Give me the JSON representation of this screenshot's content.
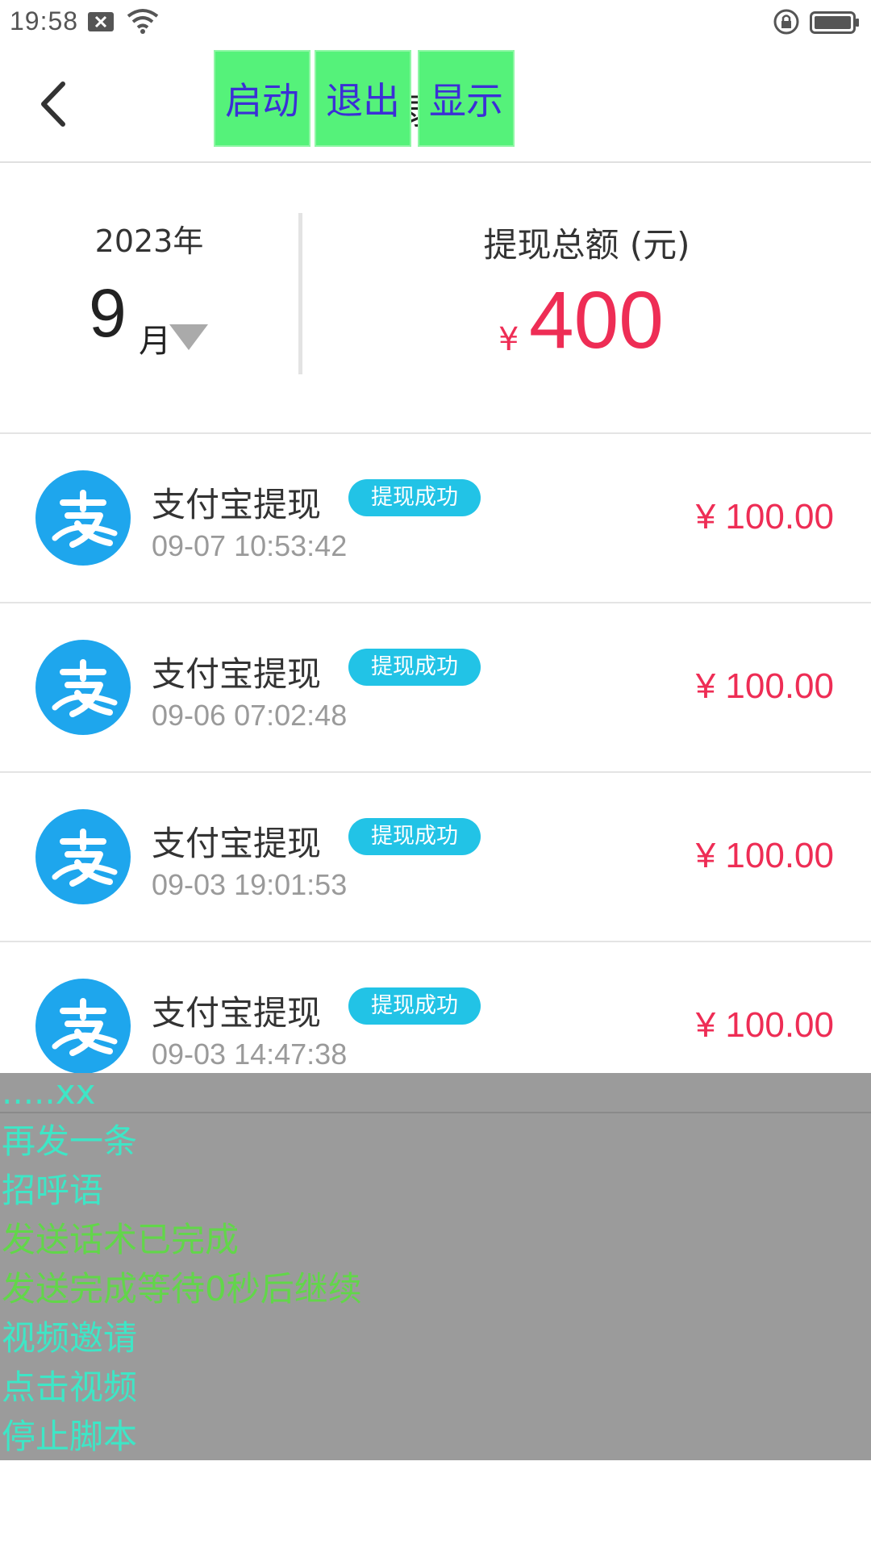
{
  "status_bar": {
    "time": "19:58",
    "icons": [
      "notification-x-icon",
      "wifi-icon",
      "screen-lock-icon",
      "battery-icon"
    ]
  },
  "header": {
    "back_icon": "back-chevron-icon",
    "title_fragment": "录",
    "overlay_buttons": {
      "start": "启动",
      "exit": "退出",
      "show": "显示"
    }
  },
  "summary": {
    "year": "2023年",
    "month": "9",
    "month_unit": "月",
    "total_label": "提现总额 (元)",
    "currency": "¥",
    "total": "400"
  },
  "records": [
    {
      "title": "支付宝提现",
      "status": "提现成功",
      "time": "09-07 10:53:42",
      "amount": "¥ 100.00"
    },
    {
      "title": "支付宝提现",
      "status": "提现成功",
      "time": "09-06 07:02:48",
      "amount": "¥ 100.00"
    },
    {
      "title": "支付宝提现",
      "status": "提现成功",
      "time": "09-03 19:01:53",
      "amount": "¥ 100.00"
    },
    {
      "title": "支付宝提现",
      "status": "提现成功",
      "time": "09-03 14:47:38",
      "amount": "¥ 100.00"
    }
  ],
  "log": {
    "lines": [
      {
        "text": ".....xx",
        "color": "#3ee6c6"
      },
      {
        "text": "再发一条",
        "color": "#3ee6c6"
      },
      {
        "text": "招呼语",
        "color": "#3ee6c6"
      },
      {
        "text": "发送话术已完成",
        "color": "#62d64a"
      },
      {
        "text": "发送完成等待0秒后继续",
        "color": "#62d64a"
      },
      {
        "text": "视频邀请",
        "color": "#3ee6c6"
      },
      {
        "text": "点击视频",
        "color": "#3ee6c6"
      },
      {
        "text": "停止脚本",
        "color": "#3ee6c6"
      }
    ]
  },
  "colors": {
    "accent_red": "#ee2d55",
    "alipay_blue": "#1ea6ed",
    "badge_cyan": "#22c3e6",
    "overlay_button_green": "#55f27a",
    "overlay_button_text": "#3b2fd6",
    "log_panel_gray": "#9b9b9b"
  }
}
